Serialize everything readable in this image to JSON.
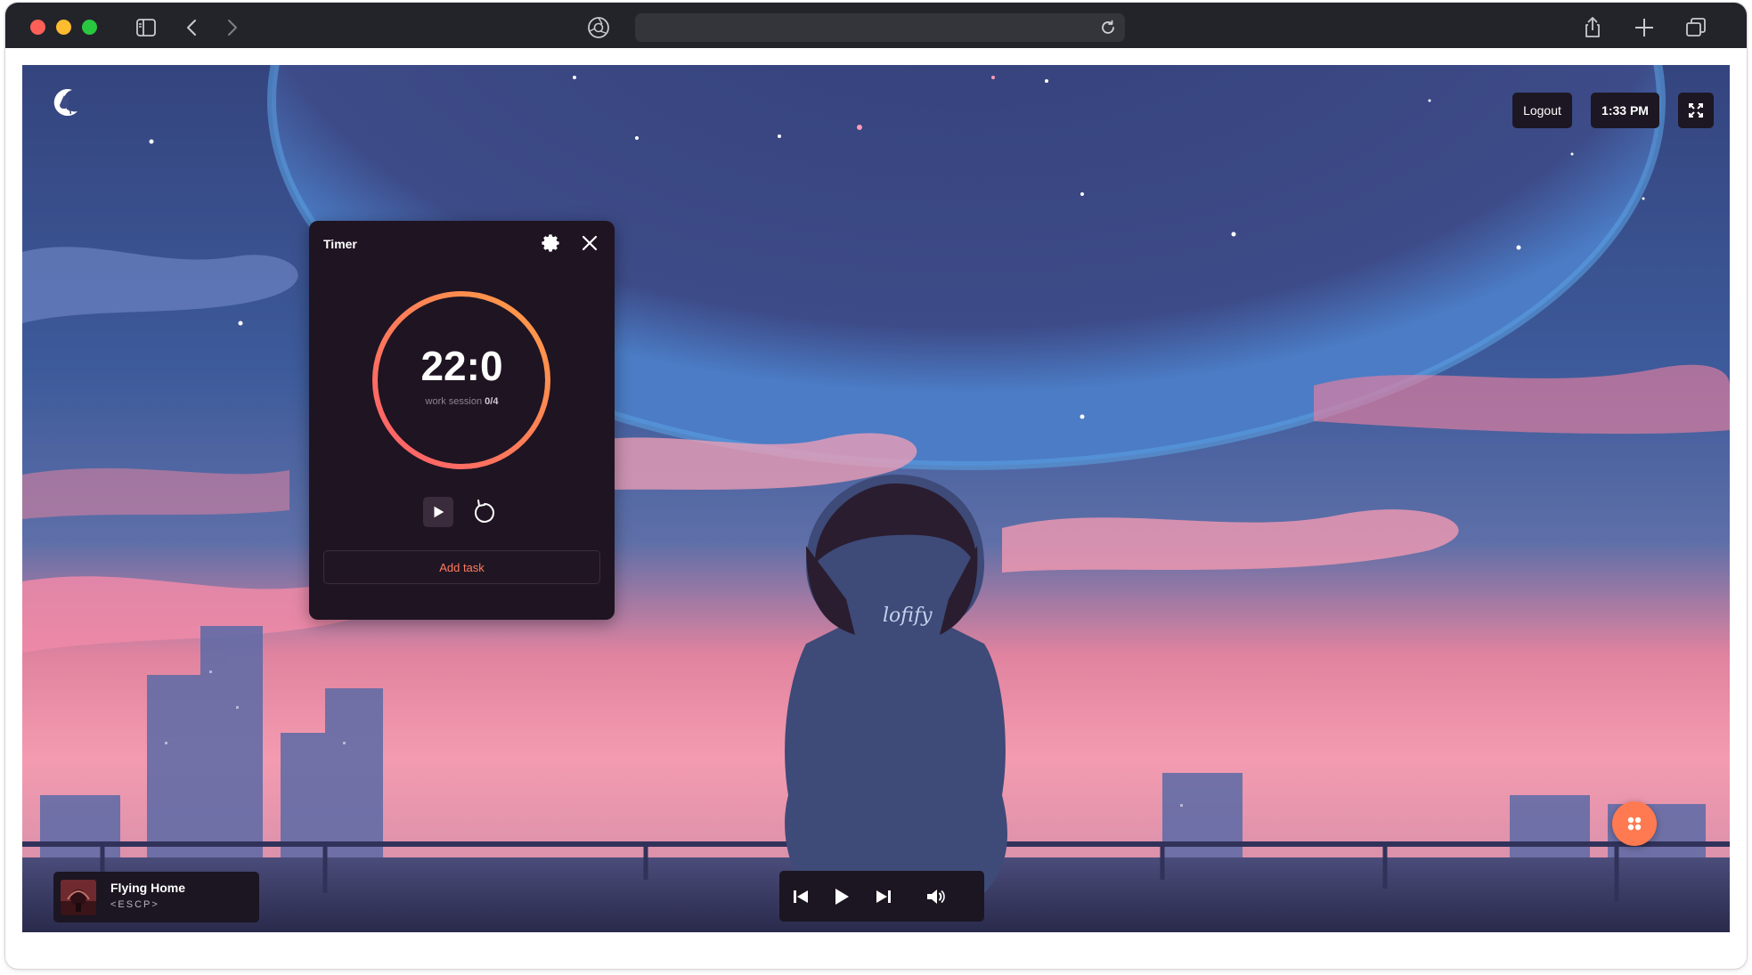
{
  "browser": {
    "address": "",
    "icons": {
      "sidebar": "sidebar-icon",
      "back": "chevron-left-icon",
      "forward": "chevron-right-icon",
      "shield": "privacy-shield-icon",
      "reload": "reload-icon",
      "share": "share-icon",
      "new_tab": "plus-icon",
      "tabs": "tab-overview-icon"
    }
  },
  "app": {
    "logo": "cat-moon-logo",
    "header": {
      "logout_label": "Logout",
      "clock_time": "1:33 PM",
      "fullscreen": "fullscreen-icon"
    },
    "background_text": "lofify"
  },
  "timer": {
    "title": "Timer",
    "time": "22:0",
    "session_label": "work session",
    "session_count": "0/4",
    "add_task_label": "Add task",
    "progress": 1.0,
    "colors": {
      "ring_start": "#ff5d6c",
      "ring_end": "#ff9e45",
      "accent": "#ff7a5c",
      "panel": "#1f1422"
    }
  },
  "now_playing": {
    "title": "Flying Home",
    "artist": "<ESCP>"
  },
  "player": {
    "buttons": [
      "previous",
      "play",
      "next",
      "volume"
    ]
  },
  "colors": {
    "sky_top": "#2f3f78",
    "sky_pink": "#f38aa8",
    "fab": "#ff7a50"
  }
}
